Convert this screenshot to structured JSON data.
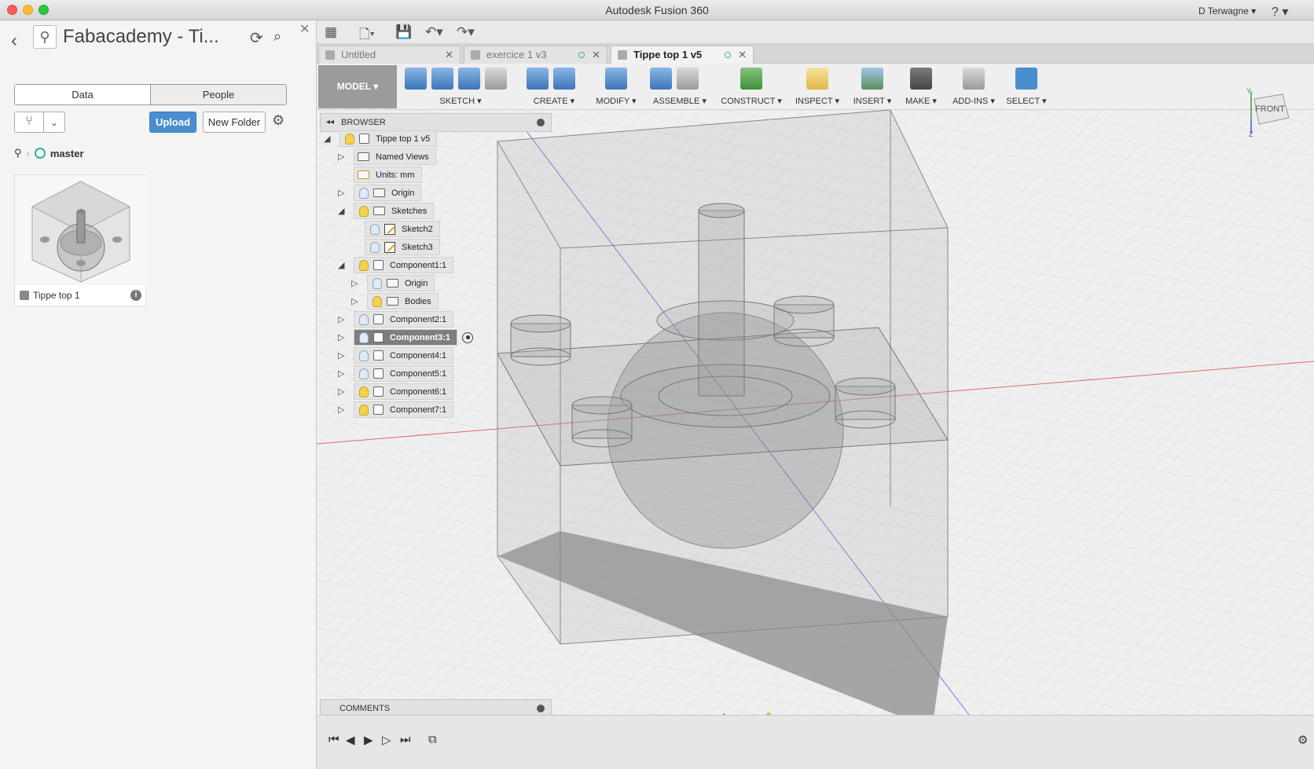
{
  "window": {
    "title": "Autodesk Fusion 360"
  },
  "data_panel": {
    "title": "Fabacademy - Ti...",
    "tabs": [
      "Data",
      "People"
    ],
    "upload_label": "Upload",
    "new_folder_label": "New Folder",
    "branch": "master",
    "file": {
      "name": "Tippe top 1"
    }
  },
  "quick_access": {
    "user": "D Terwagne ▾",
    "help": "? ▾"
  },
  "doc_tabs": [
    {
      "label": "Untitled"
    },
    {
      "label": "exercice 1 v3"
    },
    {
      "label": "Tippe top 1 v5"
    }
  ],
  "ribbon": {
    "workspace": "MODEL ▾",
    "groups": [
      "SKETCH ▾",
      "CREATE ▾",
      "MODIFY ▾",
      "ASSEMBLE ▾",
      "CONSTRUCT ▾",
      "INSPECT ▾",
      "INSERT ▾",
      "MAKE ▾",
      "ADD-INS ▾",
      "SELECT ▾"
    ]
  },
  "viewcube": {
    "face": "FRONT",
    "axis_y": "Y",
    "axis_z": "Z"
  },
  "browser": {
    "title": "BROWSER",
    "items": [
      {
        "label": "Tippe top 1 v5"
      },
      {
        "label": "Named Views"
      },
      {
        "label": "Units: mm"
      },
      {
        "label": "Origin"
      },
      {
        "label": "Sketches"
      },
      {
        "label": "Sketch2"
      },
      {
        "label": "Sketch3"
      },
      {
        "label": "Component1:1"
      },
      {
        "label": "Origin"
      },
      {
        "label": "Bodies"
      },
      {
        "label": "Component2:1"
      },
      {
        "label": "Component3:1"
      },
      {
        "label": "Component4:1"
      },
      {
        "label": "Component5:1"
      },
      {
        "label": "Component6:1"
      },
      {
        "label": "Component7:1"
      }
    ]
  },
  "comments": {
    "title": "COMMENTS"
  }
}
